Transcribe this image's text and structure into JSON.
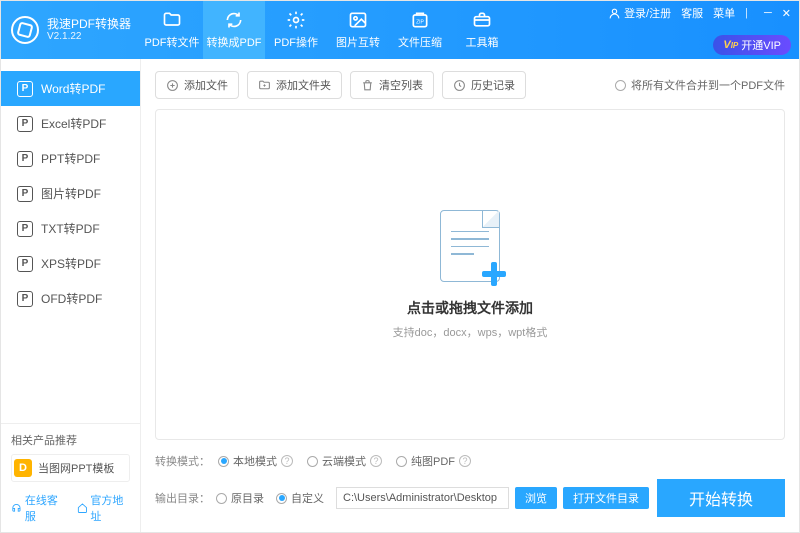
{
  "app": {
    "name": "我速PDF转换器",
    "version": "V2.1.22"
  },
  "header_right": {
    "login": "登录/注册",
    "service": "客服",
    "menu": "菜单",
    "vip": "开通VIP"
  },
  "top_tabs": [
    {
      "label": "PDF转文件"
    },
    {
      "label": "转换成PDF"
    },
    {
      "label": "PDF操作"
    },
    {
      "label": "图片互转"
    },
    {
      "label": "文件压缩"
    },
    {
      "label": "工具箱"
    }
  ],
  "sidebar": {
    "items": [
      {
        "label": "Word转PDF"
      },
      {
        "label": "Excel转PDF"
      },
      {
        "label": "PPT转PDF"
      },
      {
        "label": "图片转PDF"
      },
      {
        "label": "TXT转PDF"
      },
      {
        "label": "XPS转PDF"
      },
      {
        "label": "OFD转PDF"
      }
    ],
    "recommend_title": "相关产品推荐",
    "ad_label": "当图网PPT模板",
    "link_service": "在线客服",
    "link_site": "官方地址"
  },
  "toolbar": {
    "add_file": "添加文件",
    "add_folder": "添加文件夹",
    "clear_list": "清空列表",
    "history": "历史记录",
    "merge_label": "将所有文件合并到一个PDF文件"
  },
  "drop": {
    "title": "点击或拖拽文件添加",
    "subtitle": "支持doc，docx，wps，wpt格式"
  },
  "options": {
    "mode_label": "转换模式：",
    "mode_local": "本地模式",
    "mode_cloud": "云端模式",
    "mode_pure": "纯图PDF",
    "out_label": "输出目录：",
    "out_orig": "原目录",
    "out_custom": "自定义",
    "path": "C:\\Users\\Administrator\\Desktop",
    "browse": "浏览",
    "open_folder": "打开文件目录"
  },
  "start": "开始转换"
}
